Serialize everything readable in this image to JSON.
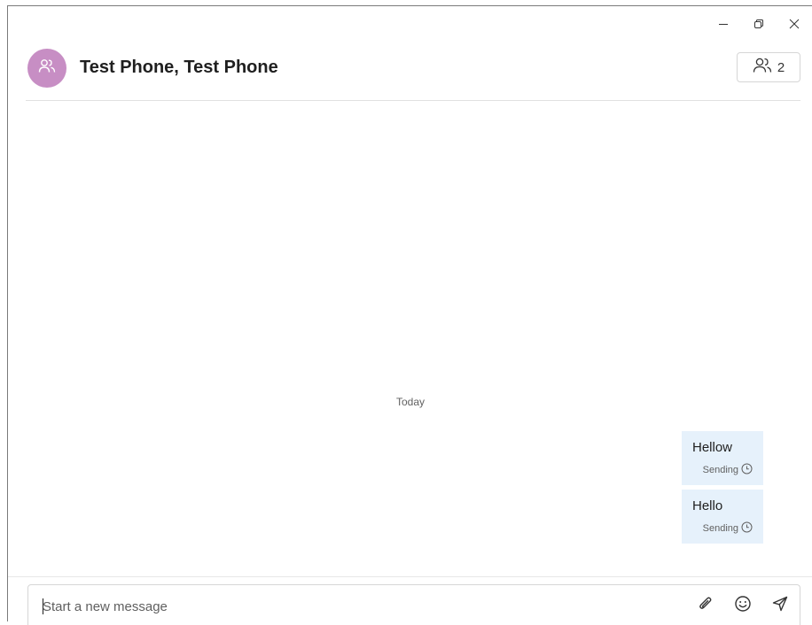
{
  "window": {
    "controls": {
      "minimize_icon": "minimize-icon",
      "restore_icon": "restore-icon",
      "close_icon": "close-icon"
    }
  },
  "header": {
    "title": "Test Phone, Test Phone",
    "avatar_icon": "group-icon",
    "avatar_color": "#c78ec4",
    "participants": {
      "icon": "people-icon",
      "count": "2"
    }
  },
  "conversation": {
    "date_separator": "Today",
    "messages": [
      {
        "text": "Hellow",
        "status": "Sending",
        "status_icon": "clock-icon"
      },
      {
        "text": "Hello",
        "status": "Sending",
        "status_icon": "clock-icon"
      }
    ],
    "bubble_color": "#e6f1fb"
  },
  "composer": {
    "placeholder": "Start a new message",
    "value": "",
    "actions": {
      "attach_icon": "paperclip-icon",
      "emoji_icon": "emoji-icon",
      "send_icon": "send-icon"
    }
  }
}
